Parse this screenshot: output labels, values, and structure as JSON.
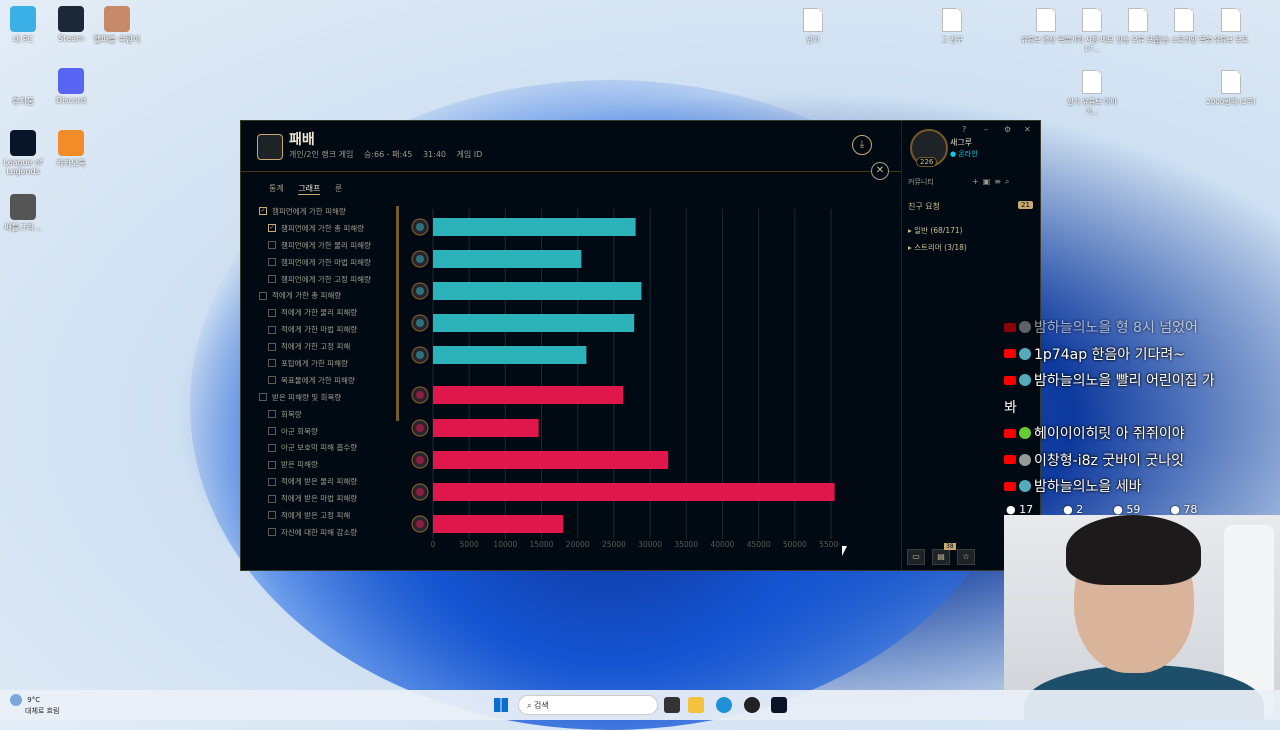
{
  "desktop": {
    "icons": [
      {
        "label": "내 PC",
        "name": "this-pc-icon",
        "color": "#3ab0e6"
      },
      {
        "label": "Steam",
        "name": "steam-icon",
        "color": "#1b2838"
      },
      {
        "label": "헬퍼블 숙탐이",
        "name": "game-shortcut-icon",
        "color": "#c68a6a"
      },
      {
        "label": "휴지통",
        "name": "recycle-bin-icon",
        "color": "#dfe9f3"
      },
      {
        "label": "Discord",
        "name": "discord-icon",
        "color": "#5865f2"
      },
      {
        "label": "League of Legends",
        "name": "league-of-legends-icon",
        "color": "#0a1428"
      },
      {
        "label": "카카오톡",
        "name": "kakao-icon",
        "color": "#f28c28"
      },
      {
        "label": "배틀그라...",
        "name": "pubg-icon",
        "color": "#555"
      }
    ],
    "files": [
      {
        "label": "인기",
        "x": 813,
        "y": 8
      },
      {
        "label": "그 친구",
        "x": 952,
        "y": 8
      },
      {
        "label": "유튜브 영상 목록",
        "x": 1046,
        "y": 8
      },
      {
        "label": "기획 사항 메모 17...",
        "x": 1092,
        "y": 8
      },
      {
        "label": "방송 오류 모음",
        "x": 1138,
        "y": 8
      },
      {
        "label": "방송 스트리밍 목록",
        "x": 1184,
        "y": 8
      },
      {
        "label": "유튜브 도트",
        "x": 1231,
        "y": 8
      },
      {
        "label": "인기 유튜브 이야기...",
        "x": 1092,
        "y": 70
      },
      {
        "label": "2000번째 (2주)",
        "x": 1231,
        "y": 70
      }
    ]
  },
  "client": {
    "title": "패배",
    "queue": "개인/2인 랭크 게임",
    "record": "승:66 - 패:45",
    "duration": "31:40",
    "game_id_label": "게임 ID",
    "tabs": [
      {
        "label": "통계",
        "active": false
      },
      {
        "label": "그래프",
        "active": true
      },
      {
        "label": "룬",
        "active": false
      }
    ],
    "options": [
      {
        "label": "챔피언에게 가한 피해량",
        "indent": false,
        "checked": true
      },
      {
        "label": "챔피언에게 가한 총 피해량",
        "indent": true,
        "checked": true
      },
      {
        "label": "챔피언에게 가한 물리 피해량",
        "indent": true,
        "checked": false
      },
      {
        "label": "챔피언에게 가한 마법 피해량",
        "indent": true,
        "checked": false
      },
      {
        "label": "챔피언에게 가한 고정 피해량",
        "indent": true,
        "checked": false
      },
      {
        "label": "적에게 가한 총 피해량",
        "indent": false,
        "checked": false
      },
      {
        "label": "적에게 가한 물리 피해량",
        "indent": true,
        "checked": false
      },
      {
        "label": "적에게 가한 마법 피해량",
        "indent": true,
        "checked": false
      },
      {
        "label": "적에게 가한 고정 피해",
        "indent": true,
        "checked": false
      },
      {
        "label": "포탑에게 가한 피해량",
        "indent": true,
        "checked": false
      },
      {
        "label": "목표물에게 가한 피해량",
        "indent": true,
        "checked": false
      },
      {
        "label": "받은 피해량 및 회복량",
        "indent": false,
        "checked": false
      },
      {
        "label": "회복량",
        "indent": true,
        "checked": false
      },
      {
        "label": "아군 회복량",
        "indent": true,
        "checked": false
      },
      {
        "label": "아군 보호막 피해 흡수량",
        "indent": true,
        "checked": false
      },
      {
        "label": "받은 피해량",
        "indent": true,
        "checked": false
      },
      {
        "label": "적에게 받은 물리 피해량",
        "indent": true,
        "checked": false
      },
      {
        "label": "적에게 받은 마법 피해량",
        "indent": true,
        "checked": false
      },
      {
        "label": "적에게 받은 고정 피해",
        "indent": true,
        "checked": false
      },
      {
        "label": "자신에 대한 피해 감소량",
        "indent": true,
        "checked": false
      }
    ]
  },
  "chart_data": {
    "type": "bar",
    "orientation": "horizontal",
    "title": "",
    "xlim": [
      0,
      55000
    ],
    "xticks": [
      "0",
      "5000",
      "10000",
      "15000",
      "20000",
      "25000",
      "30000",
      "35000",
      "40000",
      "45000",
      "50000",
      "55000"
    ],
    "grid": true,
    "series": [
      {
        "team": "blue",
        "color": "#2bb3b9",
        "values": [
          28000,
          20500,
          28800,
          27800,
          21200
        ]
      },
      {
        "team": "red",
        "color": "#e0174b",
        "values": [
          26300,
          14600,
          32500,
          55500,
          18000
        ]
      }
    ]
  },
  "social": {
    "player_name": "새그루",
    "status": "온라인",
    "level": "226",
    "community_label": "커뮤니티",
    "friend_requests_label": "친구 요청",
    "friend_requests_count": "21",
    "groups": [
      {
        "label": "일반 (68/171)"
      },
      {
        "label": "스트리머 (3/18)"
      }
    ],
    "notif_count": "38"
  },
  "chat": {
    "messages": [
      {
        "text": "밤하늘의노을 형 8시 넘었어",
        "faded": true
      },
      {
        "text": "1p74ap 한음아 기다려~",
        "faded": false
      },
      {
        "text": "밤하늘의노을 빨리 어린이집 가",
        "faded": false
      },
      {
        "text": "봐",
        "faded": false
      },
      {
        "text": "헤이이이히릿 아 쥐쥐이야",
        "faded": false
      },
      {
        "text": "이창형-i8z 굿바이 굿나잇",
        "faded": false
      },
      {
        "text": "밤하늘의노을 세바",
        "faded": false
      }
    ],
    "counts": [
      "17",
      "2",
      "59",
      "78"
    ]
  },
  "taskbar": {
    "weather_temp": "9°C",
    "weather_desc": "대체로 흐림",
    "search_placeholder": "검색"
  }
}
